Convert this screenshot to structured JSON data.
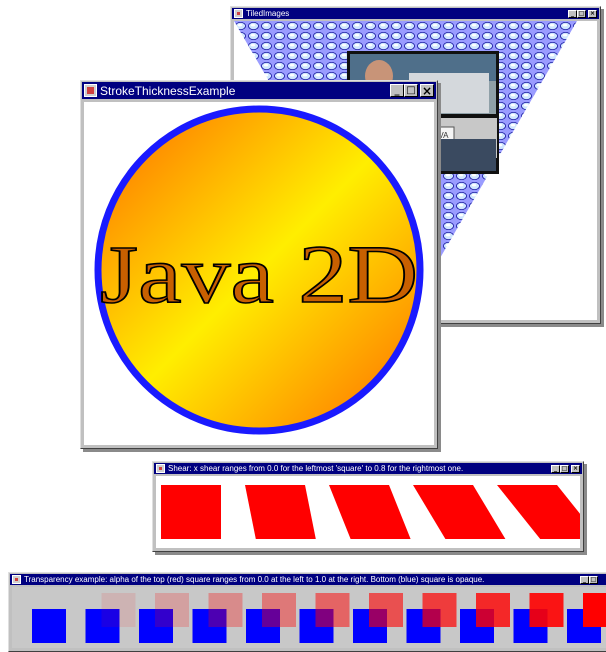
{
  "windows": {
    "tiled_images": {
      "title": "TiledImages",
      "controls": {
        "minimize": "_",
        "maximize": "□",
        "close": "×"
      },
      "photo_plate_text": "JAVA"
    },
    "stroke": {
      "title": "StrokeThicknessExample",
      "controls": {
        "minimize": "_",
        "maximize": "□",
        "close": "×"
      },
      "circle_text": "Java 2D",
      "colors": {
        "border": "#1a1aff",
        "fill_a": "#ff7a00",
        "fill_b": "#ffee00"
      }
    },
    "shear": {
      "title": "Shear: x shear ranges from 0.0 for the leftmost 'square' to 0.8 for the rightmost one.",
      "controls": {
        "minimize": "_",
        "maximize": "□",
        "close": "×"
      },
      "shears": [
        0.0,
        0.2,
        0.4,
        0.6,
        0.8
      ],
      "color": "#ff0000"
    },
    "transparency": {
      "title": "Transparency example: alpha of the top (red) square ranges from 0.0 at the left to 1.0 at the right. Bottom (blue) square is opaque.",
      "controls": {
        "minimize": "_",
        "maximize": "□",
        "close": "×"
      },
      "alphas": [
        0.0,
        0.1,
        0.2,
        0.3,
        0.4,
        0.5,
        0.6,
        0.7,
        0.8,
        0.9,
        1.0
      ],
      "top_color": "#ff0000",
      "bottom_color": "#0000ff"
    }
  }
}
